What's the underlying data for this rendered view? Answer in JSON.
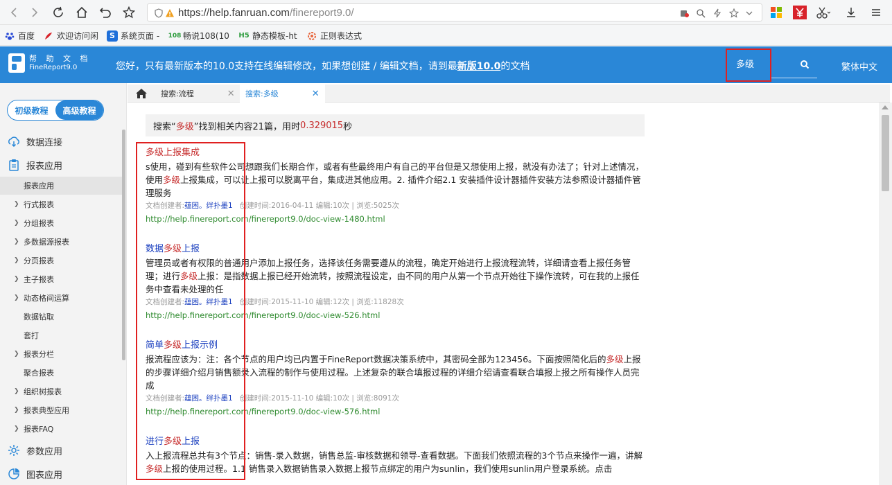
{
  "browser": {
    "url_host": "https://help.fanruan.com",
    "url_path": "/finereport9.0/",
    "bookmarks": [
      {
        "label": "百度",
        "icon": "paw-icon"
      },
      {
        "label": "欢迎访问闲",
        "icon": "swirl-icon"
      },
      {
        "label": "系统页面 -",
        "icon": "s-icon"
      },
      {
        "label": "畅说108(10",
        "icon": "108-icon"
      },
      {
        "label": "静态模板-ht",
        "icon": "h5-icon"
      },
      {
        "label": "正则表达式",
        "icon": "gear-icon"
      }
    ]
  },
  "site": {
    "logo_line1": "帮 助 文 档",
    "logo_line2": "FineReport9.0",
    "notice_before": "您好，只有最新版本的10.0支持在线编辑修改，如果想创建 / 编辑文档，请到最",
    "notice_link": "新版10.0",
    "notice_after": "的文档",
    "search_value": "多级",
    "lang_link": "繁体中文"
  },
  "sidebar": {
    "level_basic": "初级教程",
    "level_advanced": "高级教程",
    "items": [
      {
        "label": "数据连接",
        "type": "top",
        "icon": "data-connect-icon"
      },
      {
        "label": "报表应用",
        "type": "top",
        "icon": "clipboard-icon"
      },
      {
        "label": "报表应用",
        "type": "sub-active"
      },
      {
        "label": "行式报表",
        "type": "sub"
      },
      {
        "label": "分组报表",
        "type": "sub"
      },
      {
        "label": "多数据源报表",
        "type": "sub"
      },
      {
        "label": "分页报表",
        "type": "sub"
      },
      {
        "label": "主子报表",
        "type": "sub"
      },
      {
        "label": "动态格间运算",
        "type": "sub"
      },
      {
        "label": "数据钻取",
        "type": "leaf"
      },
      {
        "label": "套打",
        "type": "leaf"
      },
      {
        "label": "报表分栏",
        "type": "sub"
      },
      {
        "label": "聚合报表",
        "type": "leaf"
      },
      {
        "label": "组织树报表",
        "type": "sub"
      },
      {
        "label": "报表典型应用",
        "type": "sub"
      },
      {
        "label": "报表FAQ",
        "type": "sub"
      },
      {
        "label": "参数应用",
        "type": "top",
        "icon": "param-icon"
      },
      {
        "label": "图表应用",
        "type": "top",
        "icon": "chart-icon"
      }
    ]
  },
  "tabs": [
    {
      "label": "搜索:流程"
    },
    {
      "label": "搜索:多级"
    }
  ],
  "summary": {
    "prefix": "搜索“",
    "keyword": "多级",
    "middle": "”找到相关内容21篇，用时 ",
    "time": "0.329015",
    "suffix": " 秒"
  },
  "results": [
    {
      "t1": "",
      "t_hl": "多级",
      "t2": "上报集成",
      "s1": "s使用，碰到有些软件公司想跟我们长期合作，或者有些最终用户有自己的平台但是又想使用上报，就没有办法了；针对上述情况，使用",
      "s_hl": "多级",
      "s2": "上报集成，可以让上报可以脱离平台，集成进其他应用。2. 插件介绍2.1 安装插件设计器插件安装方法参照设计器插件管理服务",
      "meta_prefix": "文档创建者:",
      "author": "蕴困。绊扑墨1",
      "meta_rest": "创建时间:2016-04-11 编辑:10次 | 浏览:5025次",
      "link": "http://help.finereport.com/finereport9.0/doc-view-1480.html"
    },
    {
      "t1": "数据",
      "t_hl": "多级",
      "t2": "上报",
      "s1": "管理员或者有权限的普通用户添加上报任务，选择该任务需要遵从的流程，确定开始进行上报流程流转，详细请查看上报任务管理；进行",
      "s_hl": "多级",
      "s2": "上报：是指数据上报已经开始流转，按照流程设定，由不同的用户从第一个节点开始往下操作流转，可在我的上报任务中查看未处理的任",
      "meta_prefix": "文档创建者:",
      "author": "蕴困。绊扑墨1",
      "meta_rest": "创建时间:2015-11-10 编辑:12次 | 浏览:11828次",
      "link": "http://help.finereport.com/finereport9.0/doc-view-526.html"
    },
    {
      "t1": "简单",
      "t_hl": "多级",
      "t2": "上报示例",
      "s1": "报流程应该为：注：各个节点的用户均已内置于FineReport数据决策系统中，其密码全部为123456。下面按照简化后的",
      "s_hl": "多级",
      "s2": "上报的步骤详细介绍月销售额录入流程的制作与使用过程。上述复杂的联合填报过程的详细介绍请查看联合填报上报之所有操作人员完成",
      "meta_prefix": "文档创建者:",
      "author": "蕴困。绊扑墨1",
      "meta_rest": "创建时间:2015-11-10 编辑:10次 | 浏览:8091次",
      "link": "http://help.finereport.com/finereport9.0/doc-view-576.html"
    },
    {
      "t1": "进行",
      "t_hl": "多级",
      "t2": "上报",
      "s1": "入上报流程总共有3个节点：销售-录入数据，销售总监-审核数据和领导-查看数据。下面我们依照流程的3个节点来操作一遍，讲解",
      "s_hl": "多级",
      "s2": "上报的使用过程。1.1 销售录入数据销售录入数据上报节点绑定的用户为sunlin，我们使用sunlin用户登录系统。点击",
      "meta_prefix": "",
      "author": "",
      "meta_rest": "",
      "link": ""
    }
  ]
}
